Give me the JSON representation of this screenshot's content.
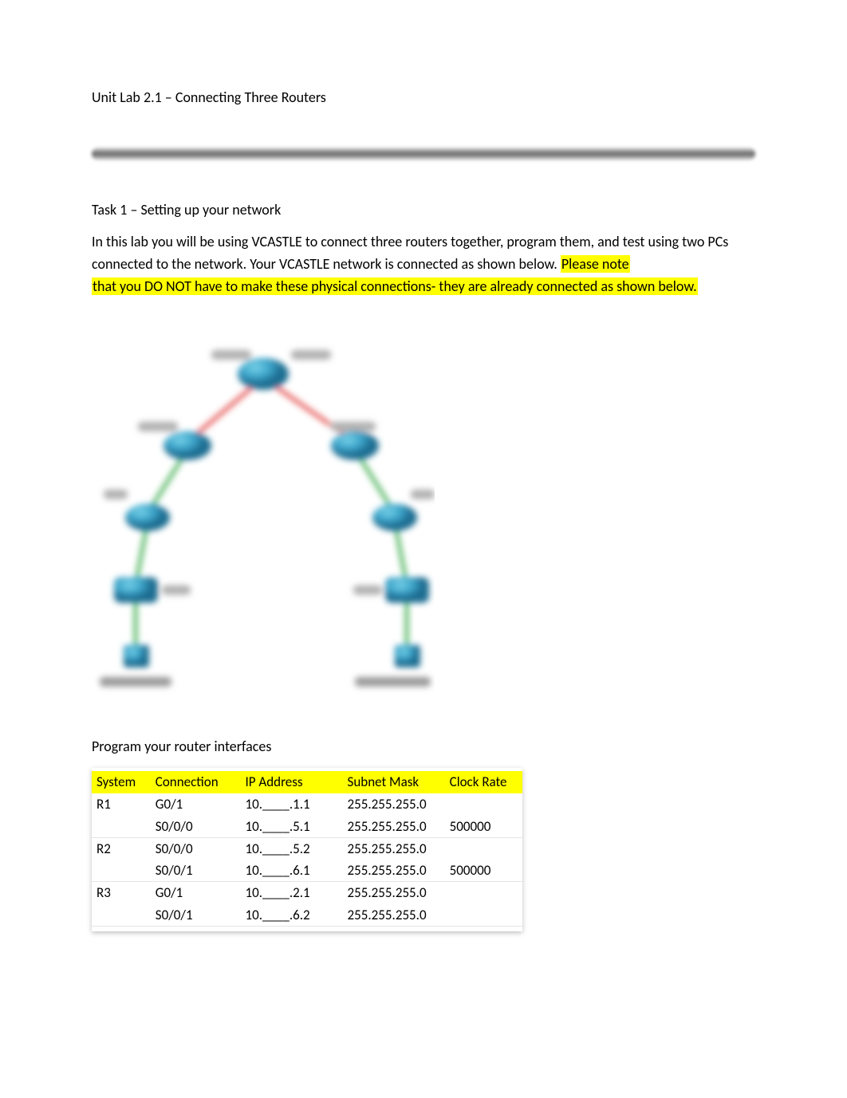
{
  "title": "Unit Lab 2.1 – Connecting Three Routers",
  "task_heading": "Task 1 – Setting up your network",
  "intro_text_1": "In this lab you will be using VCASTLE to connect three routers together, program them, and test using two PCs connected to the network.  Your VCASTLE network is connected as shown below.  ",
  "intro_highlight_1": "Please note ",
  "intro_highlight_2": "that you DO NOT have to make these physical connections- they are already connected as shown below.",
  "program_heading": "Program your router interfaces",
  "table": {
    "headers": {
      "system": "System",
      "connection": "Connection",
      "ip": "IP Address",
      "mask": "Subnet Mask",
      "clock": "Clock Rate"
    },
    "rows": [
      {
        "system": "R1",
        "connection": "G0/1",
        "ip": "10.____.1.1",
        "mask": "255.255.255.0",
        "clock": ""
      },
      {
        "system": "",
        "connection": "S0/0/0",
        "ip": "10.____.5.1",
        "mask": "255.255.255.0",
        "clock": "500000"
      },
      {
        "system": "R2",
        "connection": "S0/0/0",
        "ip": "10.____.5.2",
        "mask": "255.255.255.0",
        "clock": ""
      },
      {
        "system": "",
        "connection": "S0/0/1",
        "ip": "10.____.6.1",
        "mask": "255.255.255.0",
        "clock": "500000"
      },
      {
        "system": "R3",
        "connection": "G0/1",
        "ip": "10.____.2.1",
        "mask": "255.255.255.0",
        "clock": ""
      },
      {
        "system": "",
        "connection": "S0/0/1",
        "ip": "10.____.6.2",
        "mask": "255.255.255.0",
        "clock": ""
      }
    ]
  }
}
